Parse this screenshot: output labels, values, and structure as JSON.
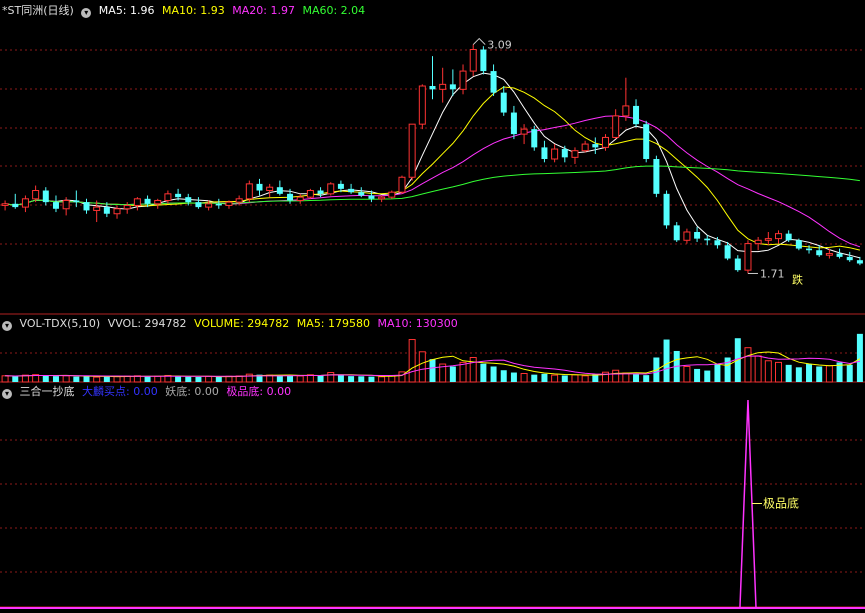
{
  "colors": {
    "background": "#000000",
    "up": "#ff3333",
    "down": "#54ffff",
    "ma5": "#ffffff",
    "ma10": "#ffff00",
    "ma20": "#ff33ff",
    "ma60": "#33ff33",
    "grid": "#8b1a1a"
  },
  "price_header": {
    "title": "*ST同洲(日线)",
    "dropdown_icon": "chevron-down-icon",
    "ma5": "MA5: 1.96",
    "ma10": "MA10: 1.93",
    "ma20": "MA20: 1.97",
    "ma60": "MA60: 2.04"
  },
  "volume_header": {
    "title": "VOL-TDX(5,10)",
    "vvol": "VVOL: 294782",
    "volume": "VOLUME: 294782",
    "ma5": "MA5: 179580",
    "ma10": "MA10: 130300"
  },
  "indicator_header": {
    "title": "三合一抄底",
    "s1": "大麟买点: 0.00",
    "s2": "妖底: 0.00",
    "s3": "极品底: 0.00"
  },
  "annotations": {
    "high": "3.09",
    "low": "1.71",
    "die": "跌",
    "jipindi": "极品底"
  },
  "chart_data": [
    {
      "type": "candlestick",
      "title": "*ST同洲(日线)",
      "ylim": [
        1.55,
        3.25
      ],
      "series": [
        {
          "name": "K线",
          "ohlc": [
            [
              2.12,
              2.15,
              2.09,
              2.13
            ],
            [
              2.13,
              2.19,
              2.1,
              2.11
            ],
            [
              2.11,
              2.18,
              2.08,
              2.16
            ],
            [
              2.16,
              2.24,
              2.14,
              2.21
            ],
            [
              2.21,
              2.23,
              2.12,
              2.14
            ],
            [
              2.14,
              2.18,
              2.08,
              2.1
            ],
            [
              2.1,
              2.17,
              2.06,
              2.15
            ],
            [
              2.15,
              2.21,
              2.11,
              2.14
            ],
            [
              2.14,
              2.16,
              2.07,
              2.09
            ],
            [
              2.09,
              2.15,
              2.02,
              2.11
            ],
            [
              2.11,
              2.14,
              2.05,
              2.07
            ],
            [
              2.07,
              2.12,
              2.04,
              2.1
            ],
            [
              2.1,
              2.14,
              2.07,
              2.12
            ],
            [
              2.12,
              2.17,
              2.09,
              2.16
            ],
            [
              2.16,
              2.18,
              2.11,
              2.13
            ],
            [
              2.13,
              2.16,
              2.1,
              2.15
            ],
            [
              2.15,
              2.21,
              2.13,
              2.19
            ],
            [
              2.19,
              2.22,
              2.15,
              2.17
            ],
            [
              2.17,
              2.19,
              2.12,
              2.14
            ],
            [
              2.14,
              2.17,
              2.1,
              2.11
            ],
            [
              2.11,
              2.15,
              2.09,
              2.13
            ],
            [
              2.13,
              2.16,
              2.1,
              2.12
            ],
            [
              2.12,
              2.15,
              2.1,
              2.14
            ],
            [
              2.14,
              2.18,
              2.12,
              2.16
            ],
            [
              2.16,
              2.27,
              2.14,
              2.25
            ],
            [
              2.25,
              2.28,
              2.18,
              2.21
            ],
            [
              2.21,
              2.25,
              2.17,
              2.23
            ],
            [
              2.23,
              2.27,
              2.18,
              2.19
            ],
            [
              2.19,
              2.22,
              2.13,
              2.15
            ],
            [
              2.15,
              2.19,
              2.13,
              2.17
            ],
            [
              2.17,
              2.22,
              2.16,
              2.21
            ],
            [
              2.21,
              2.23,
              2.17,
              2.19
            ],
            [
              2.19,
              2.26,
              2.18,
              2.25
            ],
            [
              2.25,
              2.27,
              2.2,
              2.22
            ],
            [
              2.22,
              2.25,
              2.19,
              2.2
            ],
            [
              2.2,
              2.23,
              2.17,
              2.18
            ],
            [
              2.18,
              2.21,
              2.14,
              2.16
            ],
            [
              2.16,
              2.18,
              2.14,
              2.17
            ],
            [
              2.17,
              2.21,
              2.16,
              2.2
            ],
            [
              2.2,
              2.3,
              2.19,
              2.29
            ],
            [
              2.29,
              2.61,
              2.27,
              2.61
            ],
            [
              2.61,
              2.85,
              2.58,
              2.84
            ],
            [
              2.84,
              3.02,
              2.76,
              2.82
            ],
            [
              2.82,
              2.95,
              2.74,
              2.85
            ],
            [
              2.85,
              2.94,
              2.78,
              2.82
            ],
            [
              2.82,
              2.97,
              2.79,
              2.93
            ],
            [
              2.93,
              3.09,
              2.9,
              3.06
            ],
            [
              3.06,
              3.08,
              2.91,
              2.93
            ],
            [
              2.93,
              2.97,
              2.78,
              2.8
            ],
            [
              2.8,
              2.84,
              2.66,
              2.68
            ],
            [
              2.68,
              2.72,
              2.52,
              2.55
            ],
            [
              2.55,
              2.61,
              2.49,
              2.58
            ],
            [
              2.58,
              2.6,
              2.45,
              2.47
            ],
            [
              2.47,
              2.51,
              2.38,
              2.4
            ],
            [
              2.4,
              2.49,
              2.38,
              2.46
            ],
            [
              2.46,
              2.48,
              2.38,
              2.41
            ],
            [
              2.41,
              2.47,
              2.37,
              2.45
            ],
            [
              2.45,
              2.51,
              2.44,
              2.49
            ],
            [
              2.49,
              2.53,
              2.43,
              2.47
            ],
            [
              2.47,
              2.55,
              2.45,
              2.53
            ],
            [
              2.53,
              2.7,
              2.52,
              2.66
            ],
            [
              2.66,
              2.89,
              2.63,
              2.72
            ],
            [
              2.72,
              2.76,
              2.59,
              2.61
            ],
            [
              2.61,
              2.63,
              2.38,
              2.4
            ],
            [
              2.4,
              2.42,
              2.17,
              2.19
            ],
            [
              2.19,
              2.21,
              1.98,
              2.0
            ],
            [
              2.0,
              2.02,
              1.9,
              1.91
            ],
            [
              1.91,
              1.98,
              1.89,
              1.96
            ],
            [
              1.96,
              1.99,
              1.9,
              1.92
            ],
            [
              1.92,
              1.94,
              1.88,
              1.91
            ],
            [
              1.91,
              1.93,
              1.86,
              1.88
            ],
            [
              1.88,
              1.9,
              1.79,
              1.8
            ],
            [
              1.8,
              1.82,
              1.72,
              1.73
            ],
            [
              1.73,
              1.91,
              1.71,
              1.89
            ],
            [
              1.89,
              1.93,
              1.85,
              1.91
            ],
            [
              1.91,
              1.96,
              1.88,
              1.92
            ],
            [
              1.92,
              1.97,
              1.89,
              1.95
            ],
            [
              1.95,
              1.97,
              1.9,
              1.91
            ],
            [
              1.91,
              1.92,
              1.85,
              1.86
            ],
            [
              1.86,
              1.88,
              1.83,
              1.85
            ],
            [
              1.85,
              1.88,
              1.81,
              1.82
            ],
            [
              1.82,
              1.86,
              1.8,
              1.83
            ],
            [
              1.83,
              1.86,
              1.8,
              1.81
            ],
            [
              1.81,
              1.84,
              1.78,
              1.79
            ],
            [
              1.79,
              1.81,
              1.76,
              1.77
            ]
          ]
        }
      ]
    },
    {
      "type": "bar",
      "title": "VOL-TDX(5,10)",
      "ylim": [
        0,
        300000
      ],
      "series": [
        {
          "name": "VOLUME",
          "values": [
            38000,
            35000,
            42000,
            45000,
            40000,
            36000,
            38000,
            33000,
            34000,
            30000,
            35000,
            33000,
            36000,
            38000,
            34000,
            35000,
            40000,
            36000,
            33000,
            31000,
            34000,
            32000,
            35000,
            37000,
            48000,
            45000,
            42000,
            38000,
            41000,
            37000,
            44000,
            40000,
            58000,
            42000,
            36000,
            35000,
            33000,
            32000,
            38000,
            62000,
            260000,
            185000,
            140000,
            110000,
            95000,
            120000,
            150000,
            112000,
            95000,
            72000,
            58000,
            52000,
            45000,
            50000,
            42000,
            40000,
            44000,
            38000,
            48000,
            60000,
            72000,
            55000,
            48000,
            42000,
            150000,
            260000,
            190000,
            95000,
            80000,
            70000,
            110000,
            150000,
            268000,
            210000,
            160000,
            130000,
            120000,
            105000,
            90000,
            110000,
            95000,
            100000,
            120000,
            105000,
            294782
          ]
        }
      ]
    },
    {
      "type": "line",
      "title": "三合一抄底",
      "ylim": [
        0,
        100
      ],
      "series": [
        {
          "name": "极品底",
          "values": [
            0,
            0,
            0,
            0,
            0,
            0,
            0,
            0,
            0,
            0,
            0,
            0,
            0,
            0,
            0,
            0,
            0,
            0,
            0,
            0,
            0,
            0,
            0,
            0,
            0,
            0,
            0,
            0,
            0,
            0,
            0,
            0,
            0,
            0,
            0,
            0,
            0,
            0,
            0,
            0,
            0,
            0,
            0,
            0,
            0,
            0,
            0,
            0,
            0,
            0,
            0,
            0,
            0,
            0,
            0,
            0,
            0,
            0,
            0,
            0,
            0,
            0,
            0,
            0,
            0,
            0,
            0,
            0,
            0,
            0,
            0,
            0,
            0,
            100,
            0,
            0,
            0,
            0,
            0,
            0,
            0,
            0,
            0,
            0,
            0
          ]
        }
      ]
    }
  ]
}
